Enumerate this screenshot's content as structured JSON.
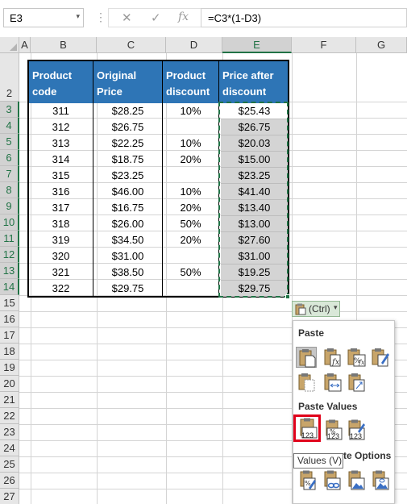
{
  "formula_bar": {
    "name_box": "E3",
    "name_box_arrow": "▾",
    "dots": "⋮",
    "cancel": "✕",
    "enter": "✓",
    "fx": "fx",
    "formula": "=C3*(1-D3)"
  },
  "columns": [
    "A",
    "B",
    "C",
    "D",
    "E",
    "F",
    "G"
  ],
  "selected_column": "E",
  "rows": [
    "2",
    "3",
    "4",
    "5",
    "6",
    "7",
    "8",
    "9",
    "10",
    "11",
    "12",
    "13",
    "14",
    "15",
    "16",
    "17",
    "18",
    "19",
    "20",
    "21",
    "22",
    "23",
    "24",
    "25",
    "26",
    "27"
  ],
  "table": {
    "headers": [
      [
        "Product",
        "code"
      ],
      [
        "Original",
        "Price"
      ],
      [
        "Product",
        "discount"
      ],
      [
        "Price after",
        "discount"
      ]
    ],
    "rows": [
      [
        "311",
        "$28.25",
        "10%",
        "$25.43"
      ],
      [
        "312",
        "$26.75",
        "",
        "$26.75"
      ],
      [
        "313",
        "$22.25",
        "10%",
        "$20.03"
      ],
      [
        "314",
        "$18.75",
        "20%",
        "$15.00"
      ],
      [
        "315",
        "$23.25",
        "",
        "$23.25"
      ],
      [
        "316",
        "$46.00",
        "10%",
        "$41.40"
      ],
      [
        "317",
        "$16.75",
        "20%",
        "$13.40"
      ],
      [
        "318",
        "$26.00",
        "50%",
        "$13.00"
      ],
      [
        "319",
        "$34.50",
        "20%",
        "$27.60"
      ],
      [
        "320",
        "$31.00",
        "",
        "$31.00"
      ],
      [
        "321",
        "$38.50",
        "50%",
        "$19.25"
      ],
      [
        "322",
        "$29.75",
        "",
        "$29.75"
      ]
    ]
  },
  "paste_ctrl": {
    "label": "(Ctrl)",
    "arrow": "▾"
  },
  "paste_menu": {
    "paste_heading": "Paste",
    "paste_values_heading": "Paste Values",
    "other_heading_partial": "te Options",
    "tooltip": "Values (V)",
    "values_label": "123"
  },
  "colors": {
    "header_fill": "#2e75b6",
    "selection_green": "#217346",
    "highlight_red": "#e0001a"
  }
}
